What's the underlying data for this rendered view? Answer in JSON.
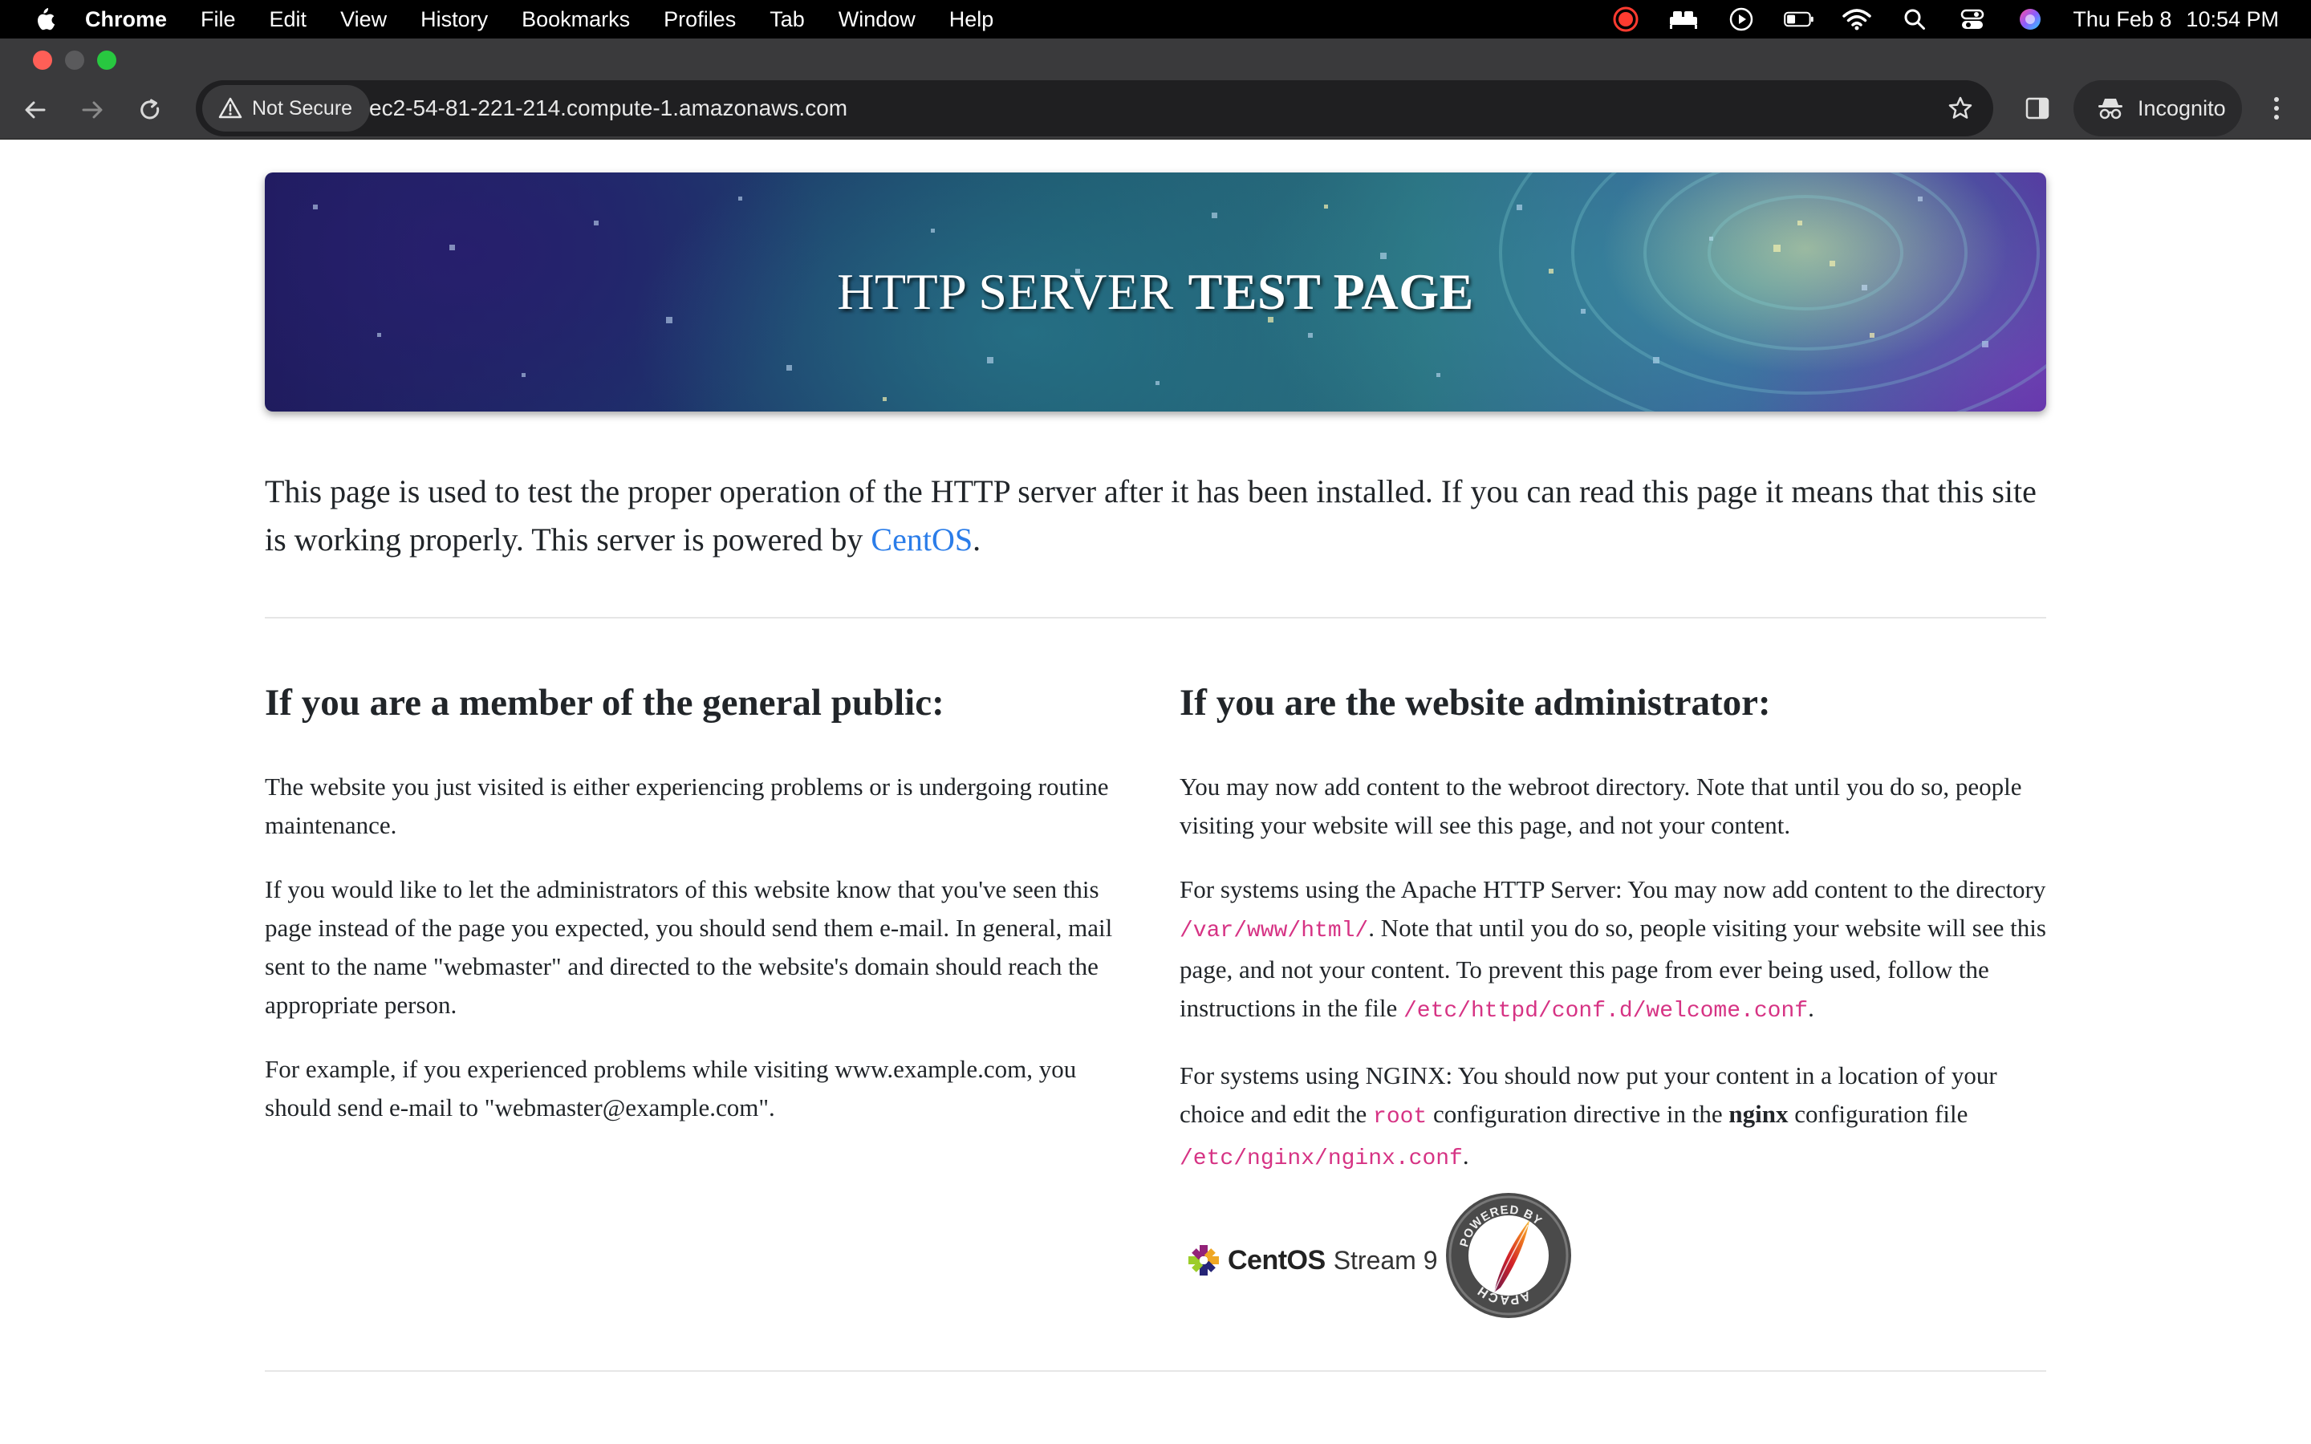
{
  "menubar": {
    "app_name": "Chrome",
    "menus": [
      "File",
      "Edit",
      "View",
      "History",
      "Bookmarks",
      "Profiles",
      "Tab",
      "Window",
      "Help"
    ],
    "clock_date": "Thu Feb 8",
    "clock_time": "10:54 PM",
    "status_icons": [
      "record-icon",
      "bed-icon",
      "play-icon",
      "battery-icon",
      "wifi-icon",
      "search-icon",
      "control-center-icon",
      "siri-icon"
    ]
  },
  "browser": {
    "security_label": "Not Secure",
    "url": "ec2-54-81-221-214.compute-1.amazonaws.com",
    "profile_label": "Incognito"
  },
  "page": {
    "banner_title_regular": "HTTP SERVER",
    "banner_title_bold": "TEST PAGE",
    "intro_text": "This page is used to test the proper operation of the HTTP server after it has been installed. If you can read this page it means that this site is working properly. This server is powered by ",
    "intro_link": "CentOS",
    "intro_end": ".",
    "public": {
      "heading": "If you are a member of the general public:",
      "p1": "The website you just visited is either experiencing problems or is undergoing routine maintenance.",
      "p2": "If you would like to let the administrators of this website know that you've seen this page instead of the page you expected, you should send them e-mail. In general, mail sent to the name \"webmaster\" and directed to the website's domain should reach the appropriate person.",
      "p3": "For example, if you experienced problems while visiting www.example.com, you should send e-mail to \"webmaster@example.com\"."
    },
    "admin": {
      "heading": "If you are the website administrator:",
      "p1": "You may now add content to the webroot directory. Note that until you do so, people visiting your website will see this page, and not your content.",
      "p2_a": "For systems using the Apache HTTP Server: You may now add content to the directory ",
      "p2_code1": "/var/www/html/",
      "p2_b": ". Note that until you do so, people visiting your website will see this page, and not your content. To prevent this page from ever being used, follow the instructions in the file ",
      "p2_code2": "/etc/httpd/conf.d/welcome.conf",
      "p2_c": ".",
      "p3_a": "For systems using NGINX: You should now put your content in a location of your choice and edit the ",
      "p3_code1": "root",
      "p3_b": " configuration directive in the ",
      "p3_bold": "nginx",
      "p3_c": " configuration file ",
      "p3_code2": "/etc/nginx/nginx.conf",
      "p3_d": "."
    },
    "logos": {
      "centos_word": "CentOS",
      "centos_stream": "Stream 9",
      "apache_badge_top": "POWERED BY",
      "apache_badge_bottom": "APACHE"
    }
  },
  "colors": {
    "link": "#2b7de9",
    "code": "#d63384",
    "text": "#212529"
  }
}
